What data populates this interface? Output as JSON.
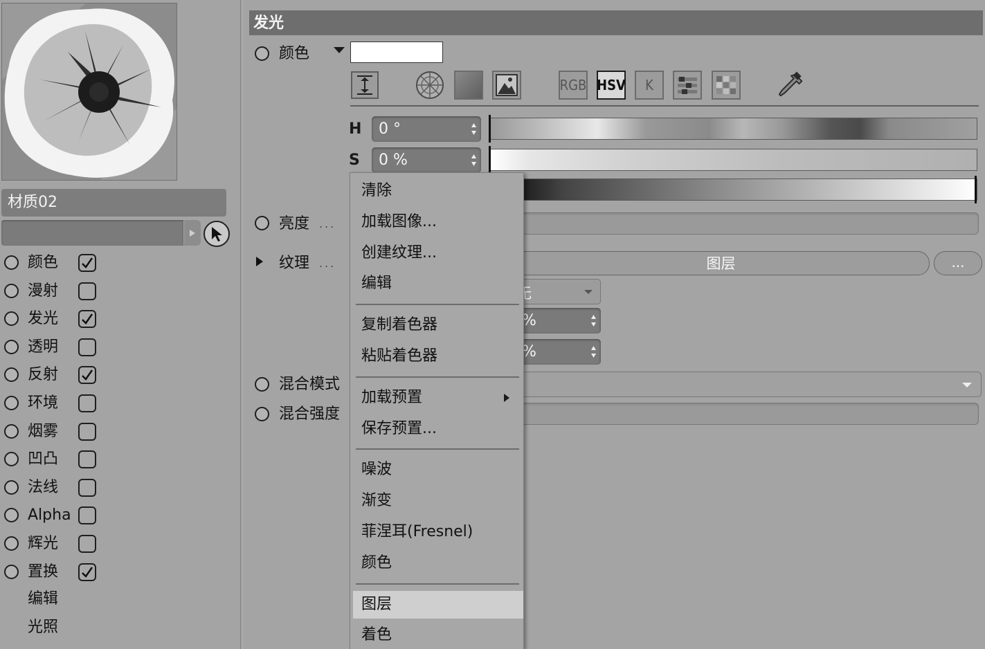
{
  "material": {
    "name": "材质02",
    "preview_icon": "flower-texture-preview"
  },
  "channels": [
    {
      "label": "颜色",
      "checkbox": true,
      "checked": true
    },
    {
      "label": "漫射",
      "checkbox": true,
      "checked": false
    },
    {
      "label": "发光",
      "checkbox": true,
      "checked": true
    },
    {
      "label": "透明",
      "checkbox": true,
      "checked": false
    },
    {
      "label": "反射",
      "checkbox": true,
      "checked": true
    },
    {
      "label": "环境",
      "checkbox": true,
      "checked": false
    },
    {
      "label": "烟雾",
      "checkbox": true,
      "checked": false
    },
    {
      "label": "凹凸",
      "checkbox": true,
      "checked": false
    },
    {
      "label": "法线",
      "checkbox": true,
      "checked": false
    },
    {
      "label": "Alpha",
      "checkbox": true,
      "checked": false
    },
    {
      "label": "辉光",
      "checkbox": true,
      "checked": false
    },
    {
      "label": "置换",
      "checkbox": true,
      "checked": true
    }
  ],
  "extra_items": [
    "编辑",
    "光照"
  ],
  "section": {
    "title": "发光"
  },
  "color_row": {
    "label": "颜色",
    "swatch_color": "#ffffff"
  },
  "color_tools": [
    {
      "name": "spectrum-icon",
      "text": ""
    },
    {
      "name": "color-wheel-icon",
      "text": ""
    },
    {
      "name": "gradient-square-icon",
      "text": ""
    },
    {
      "name": "image-picker-icon",
      "text": ""
    },
    {
      "name": "rgb-mode",
      "text": "RGB"
    },
    {
      "name": "hsv-mode",
      "text": "HSV"
    },
    {
      "name": "kelvin-mode",
      "text": "K"
    },
    {
      "name": "sliders-icon",
      "text": ""
    },
    {
      "name": "swatches-icon",
      "text": ""
    },
    {
      "name": "eyedropper-icon",
      "text": ""
    }
  ],
  "hsv": {
    "h_label": "H",
    "h_value": "0 °",
    "s_label": "S",
    "s_value": "0 %"
  },
  "brightness": {
    "label": "亮度",
    "dots": "..."
  },
  "texture": {
    "label": "纹理",
    "dots": "...",
    "button": "图层",
    "more": "..."
  },
  "partial_fields": {
    "mode_text": "无",
    "field1": "%",
    "field2": "%"
  },
  "blend_mode": {
    "label": "混合模式"
  },
  "blend_strength": {
    "label": "混合强度"
  },
  "menu": {
    "groups": [
      [
        "清除",
        "加载图像...",
        "创建纹理...",
        "编辑"
      ],
      [
        "复制着色器",
        "粘贴着色器"
      ],
      [
        "加载预置",
        "保存预置..."
      ],
      [
        "噪波",
        "渐变",
        "菲涅耳(Fresnel)",
        "颜色"
      ],
      [
        "图层",
        "着色"
      ]
    ],
    "highlighted": "图层",
    "submenu_item": "加载预置"
  }
}
